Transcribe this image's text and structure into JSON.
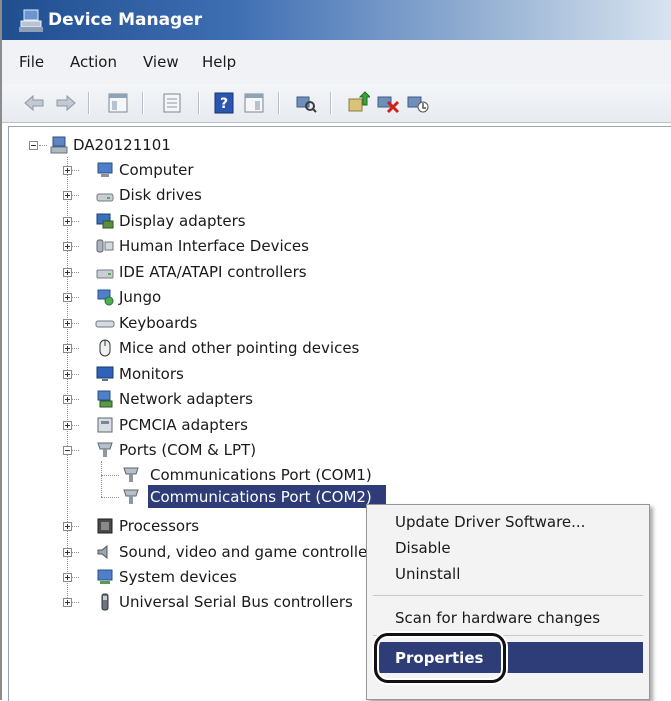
{
  "window": {
    "title": "Device Manager"
  },
  "menu": [
    "File",
    "Action",
    "View",
    "Help"
  ],
  "toolbar": {
    "icons": [
      "back-arrow",
      "forward-arrow",
      "show-hide-console-tree",
      "properties-sheet",
      "help-book",
      "action-pane",
      "scan-hardware",
      "update-driver",
      "uninstall-device",
      "enable-device"
    ]
  },
  "tree": {
    "root": "DA20121101",
    "categories": [
      "Computer",
      "Disk drives",
      "Display adapters",
      "Human Interface Devices",
      "IDE ATA/ATAPI controllers",
      "Jungo",
      "Keyboards",
      "Mice and other pointing devices",
      "Monitors",
      "Network adapters",
      "PCMCIA adapters",
      "Ports (COM & LPT)",
      "Processors",
      "Sound, video and game controllers",
      "System devices",
      "Universal Serial Bus controllers"
    ],
    "ports_children": [
      "Communications Port (COM1)",
      "Communications Port (COM2)"
    ],
    "selected": "Communications Port (COM2)"
  },
  "context_menu": {
    "items": [
      "Update Driver Software...",
      "Disable",
      "Uninstall",
      "Scan for hardware changes",
      "Properties"
    ],
    "highlighted": "Properties"
  },
  "colors": {
    "titlebar": "#1f4f8f",
    "selection": "#2e3d77",
    "selected_text": "#ffffff"
  }
}
